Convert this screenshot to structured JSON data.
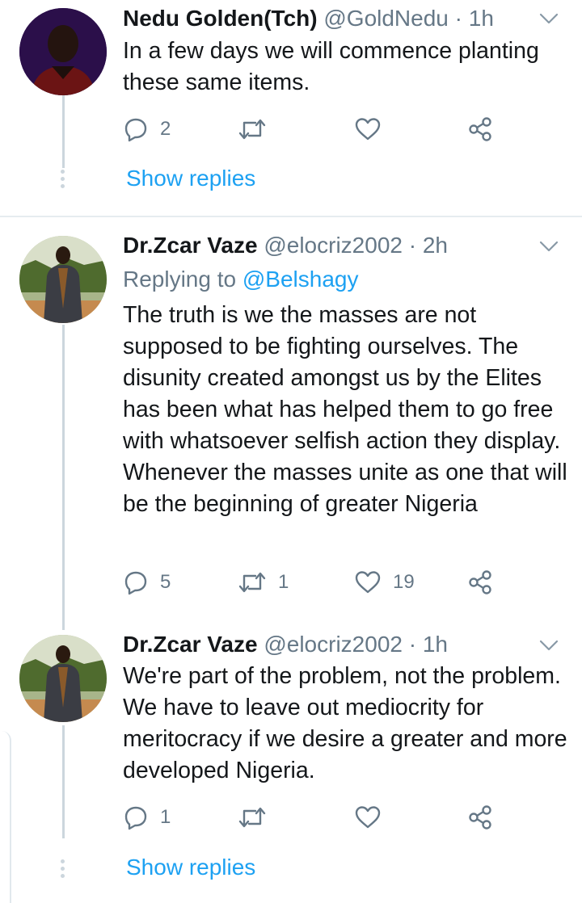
{
  "tweets": [
    {
      "name": "Nedu Golden(Tch)",
      "handle": "@GoldNedu",
      "dot": "·",
      "time": "1h",
      "replying_to_label": "",
      "replying_to_handle": "",
      "text": "In a few days we will commence planting these same items.",
      "replies": "2",
      "retweets": "",
      "likes": "",
      "show_replies": "Show replies"
    },
    {
      "name": "Dr.Zcar Vaze",
      "handle": "@elocriz2002",
      "dot": "·",
      "time": "2h",
      "replying_to_label": "Replying to",
      "replying_to_handle": "@Belshagy",
      "text": "The truth is we the masses are not supposed to be fighting ourselves. The disunity created amongst us by the Elites has been what has helped them to go free with whatsoever selfish action they display. Whenever the masses unite as one that will be the beginning of greater Nigeria",
      "replies": "5",
      "retweets": "1",
      "likes": "19",
      "show_replies": ""
    },
    {
      "name": "Dr.Zcar Vaze",
      "handle": "@elocriz2002",
      "dot": "·",
      "time": "1h",
      "replying_to_label": "",
      "replying_to_handle": "",
      "text": "We're part of the problem, not the problem. We have to leave out mediocrity for meritocracy if we desire a greater and more developed Nigeria.",
      "replies": "1",
      "retweets": "",
      "likes": "",
      "show_replies": "Show replies"
    }
  ],
  "icons": {
    "reply": "reply-icon",
    "retweet": "retweet-icon",
    "like": "heart-icon",
    "share": "share-icon",
    "more": "chevron-down-icon"
  },
  "colors": {
    "link": "#1da1f2",
    "secondary": "#657786",
    "thread_line": "#ccd6dd",
    "divider": "#e6ecf0"
  }
}
